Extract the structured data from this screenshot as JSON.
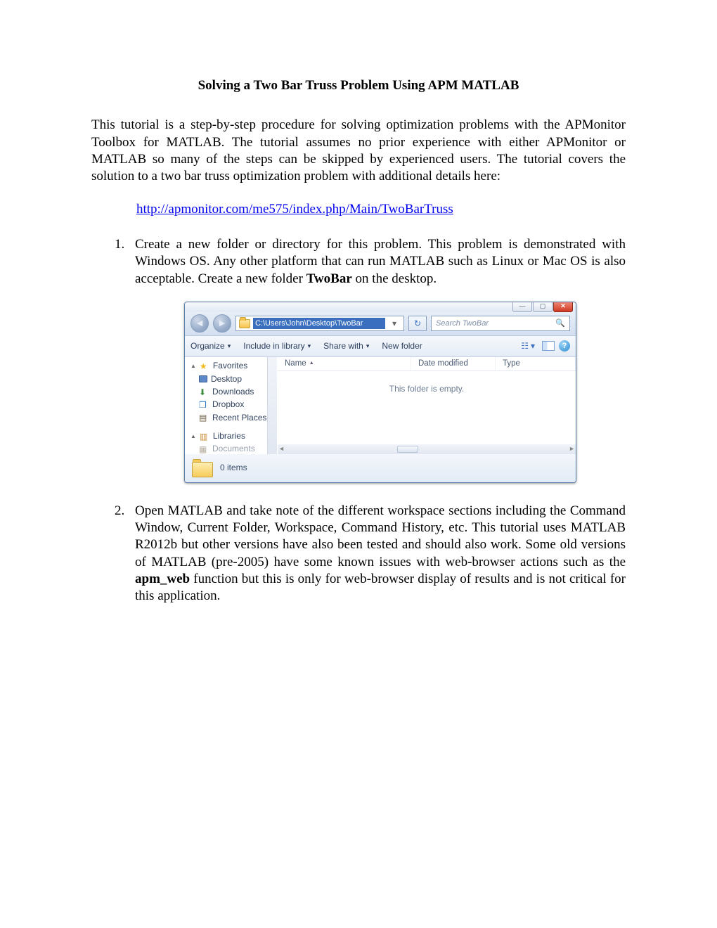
{
  "title": "Solving a Two Bar Truss Problem Using APM M",
  "title_sc": "ATLAB",
  "intro": "This tutorial is a step-by-step procedure for solving optimization problems with the APMonitor Toolbox for MATLAB. The tutorial assumes no prior experience with either APMonitor or MATLAB so many of the steps can be skipped by experienced users. The tutorial covers the solution to a two bar truss optimization problem with additional details here:",
  "link_url": "http://apmonitor.com/me575/index.php/Main/TwoBarTruss",
  "step1": {
    "pre": "Create a new folder or directory for this problem. This problem is demonstrated with Windows OS. Any other platform that can run MATLAB such as Linux or Mac OS is also acceptable. Create a new folder ",
    "bold": "TwoBar",
    "post": " on the desktop."
  },
  "step2": {
    "pre": "Open MATLAB and take note of the different workspace sections including the Command Window, Current Folder, Workspace, Command History, etc. This tutorial uses MATLAB R2012b but other versions have also been tested and should also work. Some old versions of MATLAB (pre-2005) have some known issues with web-browser actions such as the ",
    "bold": "apm_web",
    "post": " function but this is only for web-browser display of results and is not critical for this application."
  },
  "explorer": {
    "path": "C:\\Users\\John\\Desktop\\TwoBar",
    "search_placeholder": "Search TwoBar",
    "toolbar": {
      "organize": "Organize",
      "include": "Include in library",
      "share": "Share with",
      "newfolder": "New folder"
    },
    "columns": {
      "name": "Name",
      "date": "Date modified",
      "type": "Type"
    },
    "empty": "This folder is empty.",
    "sidebar": {
      "favorites": "Favorites",
      "desktop": "Desktop",
      "downloads": "Downloads",
      "dropbox": "Dropbox",
      "recent": "Recent Places",
      "libraries": "Libraries",
      "documents": "Documents"
    },
    "status": {
      "items": "0 items"
    },
    "buttons": {
      "min": "—",
      "max": "▢",
      "close": "✕"
    }
  }
}
